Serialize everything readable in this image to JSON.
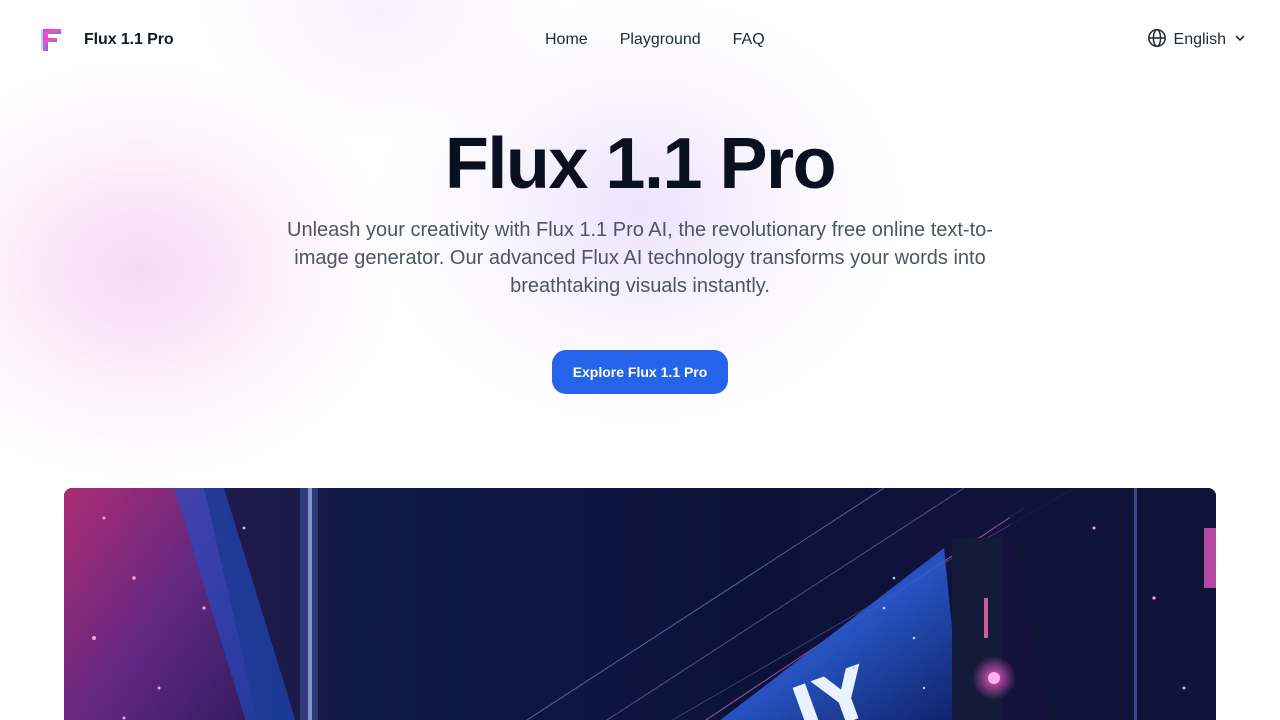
{
  "header": {
    "logo_icon": "flux-logo-icon",
    "brand_name": "Flux 1.1 Pro",
    "nav": [
      {
        "label": "Home"
      },
      {
        "label": "Playground"
      },
      {
        "label": "FAQ"
      }
    ],
    "language": {
      "icon": "globe-icon",
      "label": "English",
      "chevron_icon": "chevron-down-icon"
    }
  },
  "hero": {
    "title": "Flux 1.1 Pro",
    "subtitle": "Unleash your creativity with Flux 1.1 Pro AI, the revolutionary free online text-to-image generator. Our advanced Flux AI technology transforms your words into breathtaking visuals instantly.",
    "cta_label": "Explore Flux 1.1 Pro"
  },
  "showcase": {
    "image": "neon-city-hero-image"
  },
  "colors": {
    "accent": "#2563eb",
    "title": "#0b1020",
    "body_text": "#4b5563"
  }
}
